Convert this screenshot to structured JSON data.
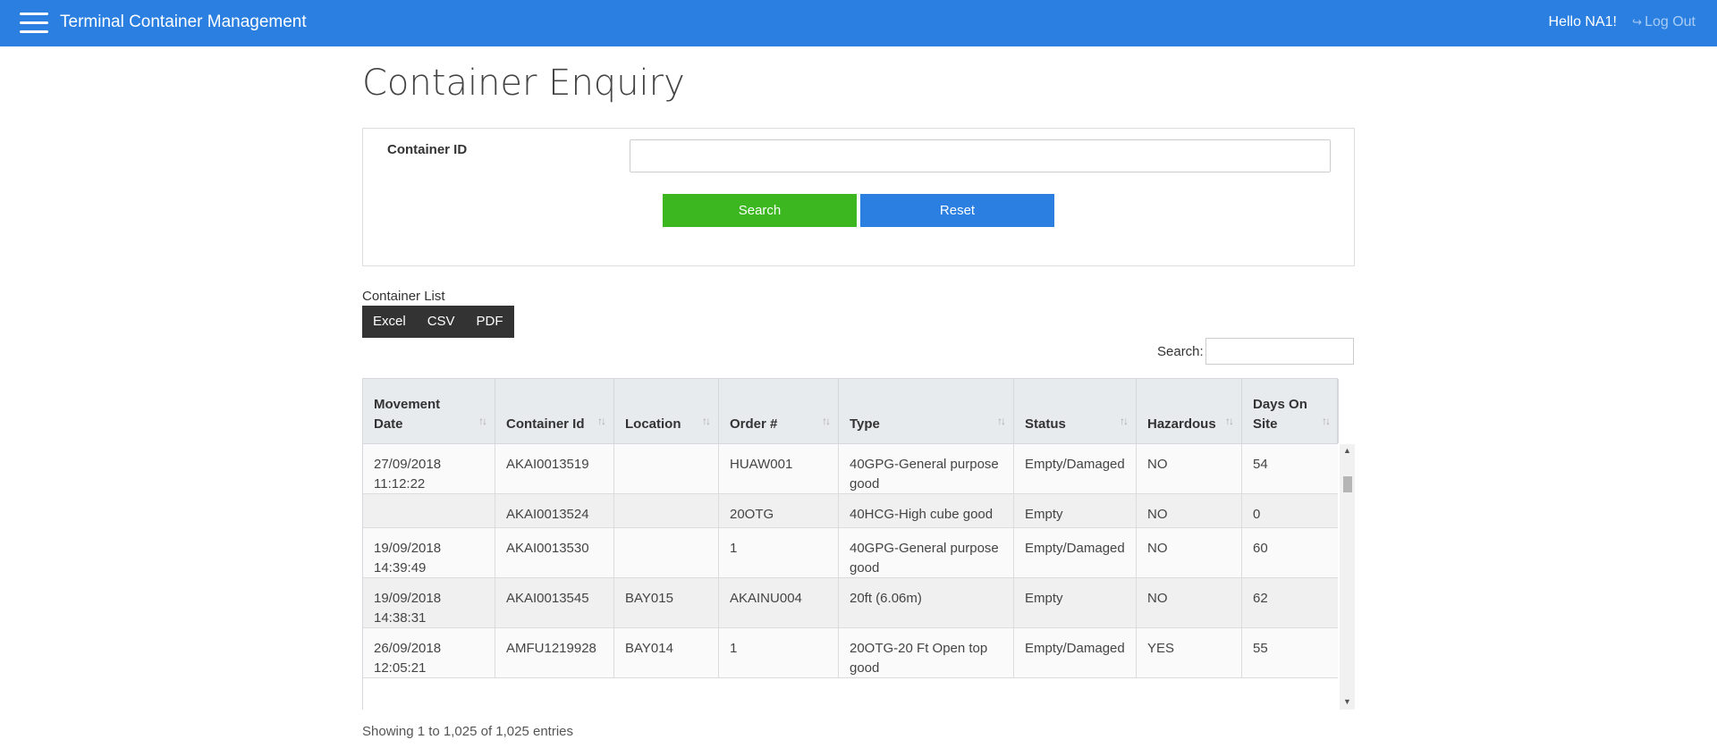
{
  "header": {
    "brand": "Terminal Container Management",
    "greeting": "Hello NA1!",
    "logout_label": "Log Out",
    "logout_icon": "sign-out-icon"
  },
  "page": {
    "title": "Container Enquiry"
  },
  "filter": {
    "container_id_label": "Container ID",
    "container_id_value": "",
    "search_label": "Search",
    "reset_label": "Reset"
  },
  "list": {
    "title": "Container List",
    "export_buttons": [
      "Excel",
      "CSV",
      "PDF"
    ],
    "search_label": "Search:",
    "search_value": "",
    "columns": [
      {
        "line1": "Movement",
        "line2": "Date"
      },
      {
        "line1": "",
        "line2": "Container Id"
      },
      {
        "line1": "",
        "line2": "Location"
      },
      {
        "line1": "",
        "line2": "Order #"
      },
      {
        "line1": "",
        "line2": "Type"
      },
      {
        "line1": "",
        "line2": "Status"
      },
      {
        "line1": "",
        "line2": "Hazardous"
      },
      {
        "line1": "Days On",
        "line2": "Site"
      }
    ],
    "rows": [
      {
        "movement_date": "27/09/2018\n11:12:22",
        "container_id": "AKAI0013519",
        "location": "",
        "order": "HUAW001",
        "type": "40GPG-General purpose\ngood",
        "status": "Empty/Damaged",
        "hazardous": "NO",
        "days_on_site": "54"
      },
      {
        "movement_date": "",
        "container_id": "AKAI0013524",
        "location": "",
        "order": "20OTG",
        "type": "40HCG-High cube good",
        "status": "Empty",
        "hazardous": "NO",
        "days_on_site": "0"
      },
      {
        "movement_date": "19/09/2018\n14:39:49",
        "container_id": "AKAI0013530",
        "location": "",
        "order": "1",
        "type": "40GPG-General purpose\ngood",
        "status": "Empty/Damaged",
        "hazardous": "NO",
        "days_on_site": "60"
      },
      {
        "movement_date": "19/09/2018\n14:38:31",
        "container_id": "AKAI0013545",
        "location": "BAY015",
        "order": "AKAINU004",
        "type": "20ft (6.06m)",
        "status": "Empty",
        "hazardous": "NO",
        "days_on_site": "62"
      },
      {
        "movement_date": "26/09/2018\n12:05:21",
        "container_id": "AMFU1219928",
        "location": "BAY014",
        "order": "1",
        "type": "20OTG-20 Ft Open top\ngood",
        "status": "Empty/Damaged",
        "hazardous": "YES",
        "days_on_site": "55"
      }
    ],
    "info": "Showing 1 to 1,025 of 1,025 entries"
  }
}
